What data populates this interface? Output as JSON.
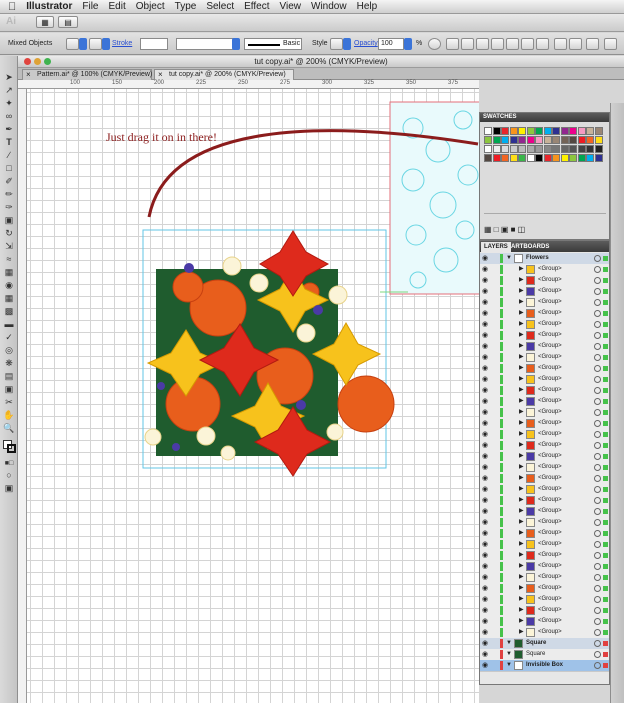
{
  "menubar": {
    "apple": "",
    "app": "Illustrator",
    "items": [
      "File",
      "Edit",
      "Object",
      "Type",
      "Select",
      "Effect",
      "View",
      "Window",
      "Help"
    ]
  },
  "toolbar": {
    "logo": "Ai"
  },
  "control_bar": {
    "selection": "Mixed Objects",
    "stroke_label": "Stroke",
    "stroke_profile": "Basic",
    "style_label": "Style",
    "opacity_label": "Opacity",
    "opacity_value": "100",
    "opacity_unit": "%"
  },
  "window": {
    "title": "tut copy.ai* @ 200% (CMYK/Preview)"
  },
  "tabs": [
    {
      "label": "Pattern.ai* @ 100% (CMYK/Preview)"
    },
    {
      "label": "tut copy.ai* @ 200% (CMYK/Preview)"
    }
  ],
  "ruler": {
    "ticks": [
      "100",
      "150",
      "200",
      "225",
      "250",
      "275",
      "300",
      "325",
      "350",
      "375",
      "400"
    ]
  },
  "annotation": "Just drag it on in there!",
  "swatches_panel": {
    "title": "SWATCHES"
  },
  "layers_panel": {
    "tab_layers": "LAYERS",
    "tab_artboards": "ARTBOARDS",
    "rows": [
      {
        "label": "Flowers",
        "type": "layer"
      },
      {
        "label": "<Group>",
        "type": "group"
      },
      {
        "label": "<Group>",
        "type": "group"
      },
      {
        "label": "<Group>",
        "type": "group"
      },
      {
        "label": "<Group>",
        "type": "group"
      },
      {
        "label": "<Group>",
        "type": "group"
      },
      {
        "label": "<Group>",
        "type": "group"
      },
      {
        "label": "<Group>",
        "type": "group"
      },
      {
        "label": "<Group>",
        "type": "group"
      },
      {
        "label": "<Group>",
        "type": "group"
      },
      {
        "label": "<Group>",
        "type": "group"
      },
      {
        "label": "<Group>",
        "type": "group"
      },
      {
        "label": "<Group>",
        "type": "group"
      },
      {
        "label": "<Group>",
        "type": "group"
      },
      {
        "label": "<Group>",
        "type": "group"
      },
      {
        "label": "<Group>",
        "type": "group"
      },
      {
        "label": "<Group>",
        "type": "group"
      },
      {
        "label": "<Group>",
        "type": "group"
      },
      {
        "label": "<Group>",
        "type": "group"
      },
      {
        "label": "<Group>",
        "type": "group"
      },
      {
        "label": "<Group>",
        "type": "group"
      },
      {
        "label": "<Group>",
        "type": "group"
      },
      {
        "label": "<Group>",
        "type": "group"
      },
      {
        "label": "<Group>",
        "type": "group"
      },
      {
        "label": "<Group>",
        "type": "group"
      },
      {
        "label": "<Group>",
        "type": "group"
      },
      {
        "label": "<Group>",
        "type": "group"
      },
      {
        "label": "<Group>",
        "type": "group"
      },
      {
        "label": "<Group>",
        "type": "group"
      },
      {
        "label": "<Group>",
        "type": "group"
      },
      {
        "label": "<Group>",
        "type": "group"
      },
      {
        "label": "<Group>",
        "type": "group"
      },
      {
        "label": "<Group>",
        "type": "group"
      },
      {
        "label": "<Group>",
        "type": "group"
      },
      {
        "label": "<Group>",
        "type": "group"
      },
      {
        "label": "Square",
        "type": "layer"
      },
      {
        "label": "Square",
        "type": "item"
      },
      {
        "label": "Invisible Box",
        "type": "layer-selected"
      }
    ]
  },
  "colors": {
    "annotation": "#8b1c1c",
    "panel_dark": "#3a3a3a",
    "square": "#1f5c2e",
    "selection": "#3fb1e0"
  }
}
